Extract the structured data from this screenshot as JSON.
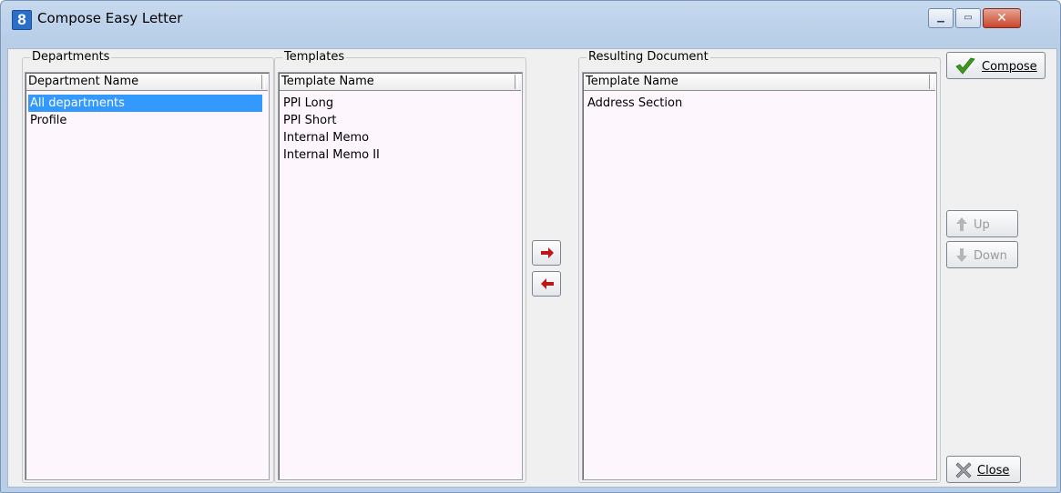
{
  "window": {
    "title": "Compose Easy Letter",
    "app_icon_glyph": "8"
  },
  "departments": {
    "group_label": "Departments",
    "column": "Department Name",
    "items": [
      "All departments",
      "Profile"
    ],
    "selected_index": 0
  },
  "templates": {
    "group_label": "Templates",
    "column": "Template Name",
    "items": [
      "PPI Long",
      "PPI Short",
      "Internal Memo",
      "Internal Memo II"
    ]
  },
  "resulting": {
    "group_label": "Resulting Document",
    "column": "Template Name",
    "items": [
      "Address Section"
    ]
  },
  "buttons": {
    "compose": "Compose",
    "up": "Up",
    "down": "Down",
    "close": "Close"
  },
  "colors": {
    "selection": "#3399ff",
    "arrow": "#c0141b",
    "list_bg": "#fdf6fd"
  }
}
